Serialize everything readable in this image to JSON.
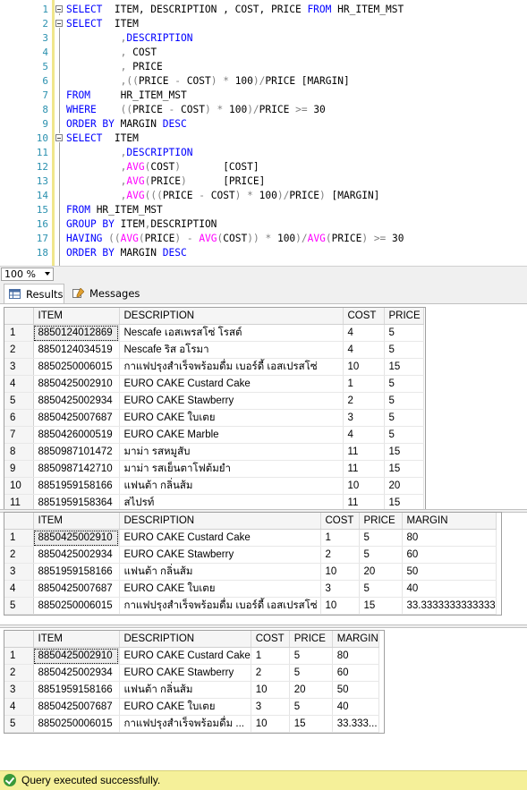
{
  "editor": {
    "lines": [
      {
        "n": "1",
        "fold": "open",
        "parts": [
          [
            "kw",
            "SELECT"
          ],
          [
            "tx",
            "  ITEM, DESCRIPTION , COST, PRICE "
          ],
          [
            "kw",
            "FROM"
          ],
          [
            "tx",
            " HR_ITEM_MST"
          ]
        ]
      },
      {
        "n": "2",
        "fold": "open",
        "parts": [
          [
            "kw",
            "SELECT"
          ],
          [
            "tx",
            "  ITEM"
          ]
        ]
      },
      {
        "n": "3",
        "parts": [
          [
            "tx",
            "         "
          ],
          [
            "op",
            ","
          ],
          [
            "kw",
            "DESCRIPTION"
          ]
        ]
      },
      {
        "n": "4",
        "parts": [
          [
            "tx",
            "         "
          ],
          [
            "op",
            ","
          ],
          [
            "tx",
            " COST"
          ]
        ]
      },
      {
        "n": "5",
        "parts": [
          [
            "tx",
            "         "
          ],
          [
            "op",
            ","
          ],
          [
            "tx",
            " PRICE"
          ]
        ]
      },
      {
        "n": "6",
        "parts": [
          [
            "tx",
            "         "
          ],
          [
            "op",
            ",(("
          ],
          [
            "tx",
            "PRICE "
          ],
          [
            "op",
            "-"
          ],
          [
            "tx",
            " COST"
          ],
          [
            "op",
            ")"
          ],
          [
            "tx",
            " "
          ],
          [
            "op",
            "*"
          ],
          [
            "tx",
            " 100"
          ],
          [
            "op",
            ")/"
          ],
          [
            "tx",
            "PRICE [MARGIN]"
          ]
        ]
      },
      {
        "n": "7",
        "parts": [
          [
            "kw",
            "FROM"
          ],
          [
            "tx",
            "     HR_ITEM_MST"
          ]
        ]
      },
      {
        "n": "8",
        "parts": [
          [
            "kw",
            "WHERE"
          ],
          [
            "tx",
            "    "
          ],
          [
            "op",
            "(("
          ],
          [
            "tx",
            "PRICE "
          ],
          [
            "op",
            "-"
          ],
          [
            "tx",
            " COST"
          ],
          [
            "op",
            ")"
          ],
          [
            "tx",
            " "
          ],
          [
            "op",
            "*"
          ],
          [
            "tx",
            " 100"
          ],
          [
            "op",
            ")/"
          ],
          [
            "tx",
            "PRICE "
          ],
          [
            "op",
            ">="
          ],
          [
            "tx",
            " 30"
          ]
        ]
      },
      {
        "n": "9",
        "parts": [
          [
            "kw",
            "ORDER BY"
          ],
          [
            "tx",
            " MARGIN "
          ],
          [
            "kw",
            "DESC"
          ]
        ]
      },
      {
        "n": "10",
        "fold": "open",
        "parts": [
          [
            "kw",
            "SELECT"
          ],
          [
            "tx",
            "  ITEM"
          ]
        ]
      },
      {
        "n": "11",
        "parts": [
          [
            "tx",
            "         "
          ],
          [
            "op",
            ","
          ],
          [
            "kw",
            "DESCRIPTION"
          ]
        ]
      },
      {
        "n": "12",
        "parts": [
          [
            "tx",
            "         "
          ],
          [
            "op",
            ","
          ],
          [
            "fn",
            "AVG"
          ],
          [
            "op",
            "("
          ],
          [
            "tx",
            "COST"
          ],
          [
            "op",
            ")"
          ],
          [
            "tx",
            "       [COST]"
          ]
        ]
      },
      {
        "n": "13",
        "parts": [
          [
            "tx",
            "         "
          ],
          [
            "op",
            ","
          ],
          [
            "fn",
            "AVG"
          ],
          [
            "op",
            "("
          ],
          [
            "tx",
            "PRICE"
          ],
          [
            "op",
            ")"
          ],
          [
            "tx",
            "      [PRICE]"
          ]
        ]
      },
      {
        "n": "14",
        "parts": [
          [
            "tx",
            "         "
          ],
          [
            "op",
            ","
          ],
          [
            "fn",
            "AVG"
          ],
          [
            "op",
            "((("
          ],
          [
            "tx",
            "PRICE "
          ],
          [
            "op",
            "-"
          ],
          [
            "tx",
            " COST"
          ],
          [
            "op",
            ")"
          ],
          [
            "tx",
            " "
          ],
          [
            "op",
            "*"
          ],
          [
            "tx",
            " 100"
          ],
          [
            "op",
            ")/"
          ],
          [
            "tx",
            "PRICE"
          ],
          [
            "op",
            ")"
          ],
          [
            "tx",
            " [MARGIN]"
          ]
        ]
      },
      {
        "n": "15",
        "parts": [
          [
            "kw",
            "FROM"
          ],
          [
            "tx",
            " HR_ITEM_MST"
          ]
        ]
      },
      {
        "n": "16",
        "parts": [
          [
            "kw",
            "GROUP BY"
          ],
          [
            "tx",
            " ITEM"
          ],
          [
            "op",
            ","
          ],
          [
            "tx",
            "DESCRIPTION"
          ]
        ]
      },
      {
        "n": "17",
        "parts": [
          [
            "kw",
            "HAVING"
          ],
          [
            "tx",
            " "
          ],
          [
            "op",
            "(("
          ],
          [
            "fn",
            "AVG"
          ],
          [
            "op",
            "("
          ],
          [
            "tx",
            "PRICE"
          ],
          [
            "op",
            ")"
          ],
          [
            "tx",
            " "
          ],
          [
            "op",
            "-"
          ],
          [
            "tx",
            " "
          ],
          [
            "fn",
            "AVG"
          ],
          [
            "op",
            "("
          ],
          [
            "tx",
            "COST"
          ],
          [
            "op",
            "))"
          ],
          [
            "tx",
            " "
          ],
          [
            "op",
            "*"
          ],
          [
            "tx",
            " 100"
          ],
          [
            "op",
            ")/"
          ],
          [
            "fn",
            "AVG"
          ],
          [
            "op",
            "("
          ],
          [
            "tx",
            "PRICE"
          ],
          [
            "op",
            ")"
          ],
          [
            "tx",
            " "
          ],
          [
            "op",
            ">="
          ],
          [
            "tx",
            " 30"
          ]
        ]
      },
      {
        "n": "18",
        "parts": [
          [
            "kw",
            "ORDER BY"
          ],
          [
            "tx",
            " MARGIN "
          ],
          [
            "kw",
            "DESC"
          ]
        ]
      }
    ]
  },
  "zoom": {
    "value": "100 %"
  },
  "tabs": {
    "results": "Results",
    "messages": "Messages"
  },
  "grids": [
    {
      "columns": [
        "ITEM",
        "DESCRIPTION",
        "COST",
        "PRICE"
      ],
      "rows": [
        [
          "1",
          "8850124012869",
          "Nescafe เอสเพรสโซ่ โรสต์",
          "4",
          "5"
        ],
        [
          "2",
          "8850124034519",
          "Nescafe ริส อโรมา",
          "4",
          "5"
        ],
        [
          "3",
          "8850250006015",
          "กาแฟปรุงสำเร็จพร้อมดื่ม เบอร์ดี้ เอสเปรสโซ่",
          "10",
          "15"
        ],
        [
          "4",
          "8850425002910",
          "EURO CAKE Custard Cake",
          "1",
          "5"
        ],
        [
          "5",
          "8850425002934",
          "EURO CAKE Stawberry",
          "2",
          "5"
        ],
        [
          "6",
          "8850425007687",
          "EURO CAKE ใบเตย",
          "3",
          "5"
        ],
        [
          "7",
          "8850426000519",
          "EURO CAKE Marble",
          "4",
          "5"
        ],
        [
          "8",
          "8850987101472",
          "มาม่า รสหมูสับ",
          "11",
          "15"
        ],
        [
          "9",
          "8850987142710",
          "มาม่า รสเย็นตาโฟต้มยำ",
          "11",
          "15"
        ],
        [
          "10",
          "8851959158166",
          "แฟนต้า กลิ่นส้ม",
          "10",
          "20"
        ],
        [
          "11",
          "8851959158364",
          "สไปรท์",
          "11",
          "15"
        ]
      ]
    },
    {
      "columns": [
        "ITEM",
        "DESCRIPTION",
        "COST",
        "PRICE",
        "MARGIN"
      ],
      "rows": [
        [
          "1",
          "8850425002910",
          "EURO CAKE Custard Cake",
          "1",
          "5",
          "80"
        ],
        [
          "2",
          "8850425002934",
          "EURO CAKE Stawberry",
          "2",
          "5",
          "60"
        ],
        [
          "3",
          "8851959158166",
          "แฟนต้า กลิ่นส้ม",
          "10",
          "20",
          "50"
        ],
        [
          "4",
          "8850425007687",
          "EURO CAKE ใบเตย",
          "3",
          "5",
          "40"
        ],
        [
          "5",
          "8850250006015",
          "กาแฟปรุงสำเร็จพร้อมดื่ม เบอร์ดี้ เอสเปรสโซ่",
          "10",
          "15",
          "33.3333333333333"
        ]
      ]
    },
    {
      "columns": [
        "ITEM",
        "DESCRIPTION",
        "COST",
        "PRICE",
        "MARGIN"
      ],
      "rows": [
        [
          "1",
          "8850425002910",
          "EURO CAKE Custard Cake",
          "1",
          "5",
          "80"
        ],
        [
          "2",
          "8850425002934",
          "EURO CAKE Stawberry",
          "2",
          "5",
          "60"
        ],
        [
          "3",
          "8851959158166",
          "แฟนต้า กลิ่นส้ม",
          "10",
          "20",
          "50"
        ],
        [
          "4",
          "8850425007687",
          "EURO CAKE ใบเตย",
          "3",
          "5",
          "40"
        ],
        [
          "5",
          "8850250006015",
          "กาแฟปรุงสำเร็จพร้อมดื่ม ...",
          "10",
          "15",
          "33.333..."
        ]
      ]
    }
  ],
  "status": {
    "text": "Query executed successfully."
  },
  "colors": {
    "keyword": "#0000ff",
    "function": "#ff00ff",
    "operator": "#808080",
    "line_number": "#2b91af",
    "status_bg": "#f5f099"
  }
}
